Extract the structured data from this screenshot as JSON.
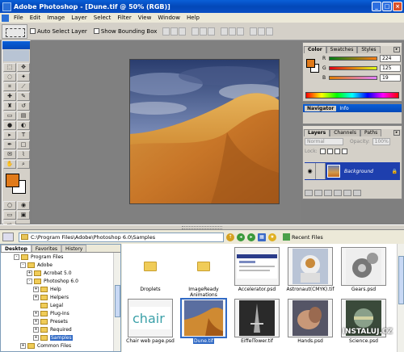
{
  "window": {
    "title": "Adobe Photoshop - [Dune.tif @ 50% (RGB)]"
  },
  "menu": [
    "File",
    "Edit",
    "Image",
    "Layer",
    "Select",
    "Filter",
    "View",
    "Window",
    "Help"
  ],
  "options": {
    "auto_select_layer": "Auto Select Layer",
    "show_bounding_box": "Show Bounding Box"
  },
  "color_panel": {
    "tabs": [
      "Color",
      "Swatches",
      "Styles"
    ],
    "channels": [
      {
        "label": "R",
        "value": "224"
      },
      {
        "label": "G",
        "value": "125"
      },
      {
        "label": "B",
        "value": "19"
      }
    ],
    "foreground": "#e07a1a"
  },
  "navigator": {
    "tabs": [
      "Navigator",
      "Info"
    ]
  },
  "layers": {
    "tabs": [
      "Layers",
      "Channels",
      "Paths"
    ],
    "blend_mode": "Normal",
    "opacity_label": "Opacity:",
    "opacity": "100%",
    "lock_label": "Lock:",
    "layer_name": "Background"
  },
  "file_browser": {
    "path": "C:\\Program Files\\Adobe\\Photoshop 6.0\\Samples",
    "recent_files": "Recent Files",
    "tree_tabs": [
      "Desktop",
      "Favorites",
      "History"
    ],
    "tree": [
      {
        "label": "Program Files",
        "indent": 2,
        "exp": "-"
      },
      {
        "label": "Adobe",
        "indent": 3,
        "exp": "-"
      },
      {
        "label": "Acrobat 5.0",
        "indent": 4,
        "exp": "+"
      },
      {
        "label": "Photoshop 6.0",
        "indent": 4,
        "exp": "-"
      },
      {
        "label": "Help",
        "indent": 5,
        "exp": "+"
      },
      {
        "label": "Helpers",
        "indent": 5,
        "exp": "+"
      },
      {
        "label": "Legal",
        "indent": 5,
        "exp": ""
      },
      {
        "label": "Plug-Ins",
        "indent": 5,
        "exp": "+"
      },
      {
        "label": "Presets",
        "indent": 5,
        "exp": "+"
      },
      {
        "label": "Required",
        "indent": 5,
        "exp": "+"
      },
      {
        "label": "Samples",
        "indent": 5,
        "exp": "+",
        "selected": true
      },
      {
        "label": "Common Files",
        "indent": 3,
        "exp": "+"
      }
    ],
    "files": [
      {
        "name": "Droplets",
        "kind": "folder"
      },
      {
        "name": "ImageReady Animations",
        "kind": "folder"
      },
      {
        "name": "Accelerator.psd",
        "kind": "accel"
      },
      {
        "name": "Astronaut(CMYK).tif",
        "kind": "astro"
      },
      {
        "name": "Gears.psd",
        "kind": "gears"
      },
      {
        "name": "Chair web page.psd",
        "kind": "chair"
      },
      {
        "name": "Dune.tif",
        "kind": "dune",
        "selected": true
      },
      {
        "name": "EiffelTower.tif",
        "kind": "eiffel"
      },
      {
        "name": "Hands.psd",
        "kind": "hands"
      },
      {
        "name": "Science.psd",
        "kind": "science"
      }
    ]
  },
  "watermark": {
    "brand": "INSTALUJ",
    "tld": ".CZ"
  }
}
